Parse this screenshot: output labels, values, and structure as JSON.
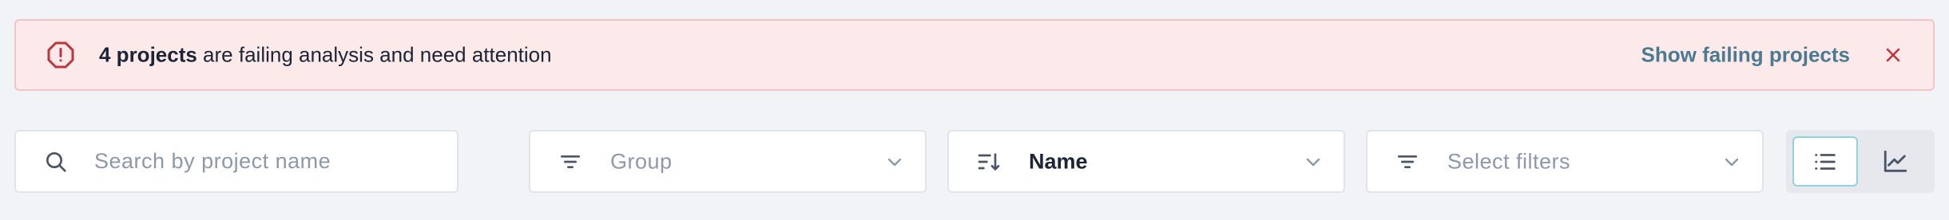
{
  "alert": {
    "count_text": "4 projects",
    "message_text": " are failing analysis and need attention",
    "link_label": "Show failing projects",
    "icon": "alert-octagon-icon",
    "close_icon": "close-icon",
    "colors": {
      "background": "#fce9e9",
      "border": "#f2c4c6",
      "accent": "#c0343c",
      "link": "#4a7b91"
    }
  },
  "toolbar": {
    "search": {
      "placeholder": "Search by project name",
      "value": "",
      "icon": "search-icon"
    },
    "group": {
      "placeholder": "Group",
      "icon": "filter-lines-icon"
    },
    "sort": {
      "value": "Name",
      "icon": "sort-icon"
    },
    "filters": {
      "placeholder": "Select filters",
      "icon": "filter-lines-icon"
    },
    "view_toggle": {
      "options": [
        {
          "name": "list",
          "icon": "list-icon",
          "selected": true
        },
        {
          "name": "chart",
          "icon": "line-chart-icon",
          "selected": false
        }
      ]
    }
  }
}
